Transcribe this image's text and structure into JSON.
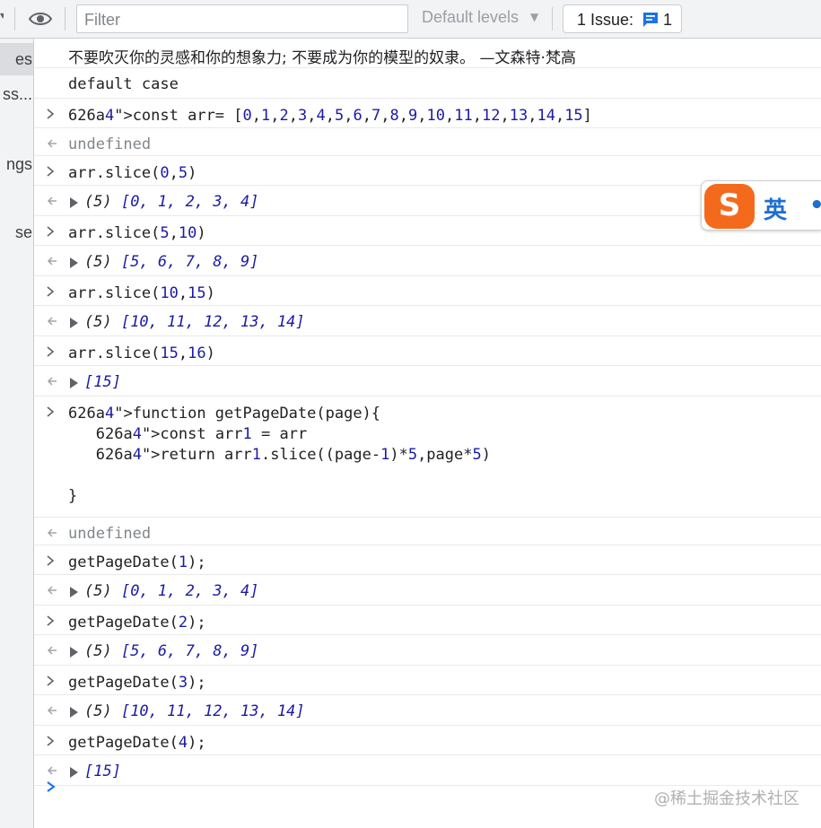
{
  "toolbar": {
    "filter_placeholder": "Filter",
    "levels_label": "Default levels",
    "issues_label": "1 Issue:",
    "issues_count": "1"
  },
  "sidebar": {
    "items": [
      "es",
      "ss...",
      "ngs",
      "se"
    ]
  },
  "console": {
    "quote": "不要吹灭你的灵感和你的想象力; 不要成为你的模型的奴隶。 —文森特·梵高",
    "default_case": "default case",
    "entries": [
      {
        "kind": "input",
        "text": "const arr= [0,1,2,3,4,5,6,7,8,9,10,11,12,13,14,15]"
      },
      {
        "kind": "undef",
        "text": "undefined"
      },
      {
        "kind": "input",
        "text": "arr.slice(0,5)"
      },
      {
        "kind": "output",
        "text": "(5) [0, 1, 2, 3, 4]"
      },
      {
        "kind": "input",
        "text": "arr.slice(5,10)"
      },
      {
        "kind": "output",
        "text": "(5) [5, 6, 7, 8, 9]"
      },
      {
        "kind": "input",
        "text": "arr.slice(10,15)"
      },
      {
        "kind": "output",
        "text": "(5) [10, 11, 12, 13, 14]"
      },
      {
        "kind": "input",
        "text": "arr.slice(15,16)"
      },
      {
        "kind": "output",
        "text": "[15]"
      },
      {
        "kind": "input",
        "text": "function getPageDate(page){\n   const arr1 = arr\n   return arr1.slice((page-1)*5,page*5)\n\n}"
      },
      {
        "kind": "undef",
        "text": "undefined"
      },
      {
        "kind": "input",
        "text": "getPageDate(1);"
      },
      {
        "kind": "output",
        "text": "(5) [0, 1, 2, 3, 4]"
      },
      {
        "kind": "input",
        "text": "getPageDate(2);"
      },
      {
        "kind": "output",
        "text": "(5) [5, 6, 7, 8, 9]"
      },
      {
        "kind": "input",
        "text": "getPageDate(3);"
      },
      {
        "kind": "output",
        "text": "(5) [10, 11, 12, 13, 14]"
      },
      {
        "kind": "input",
        "text": "getPageDate(4);"
      },
      {
        "kind": "output",
        "text": "[15]"
      }
    ]
  },
  "ime": {
    "logo_letter": "S",
    "mode_label": "英",
    "dot": "•"
  },
  "watermark": "@稀土掘金技术社区",
  "colors": {
    "keyword": "#a626a4",
    "string": "#1a1aa6",
    "prompt_active": "#1a73e8",
    "ime_orange": "#f46a1c",
    "ime_blue": "#1f6fd1"
  }
}
